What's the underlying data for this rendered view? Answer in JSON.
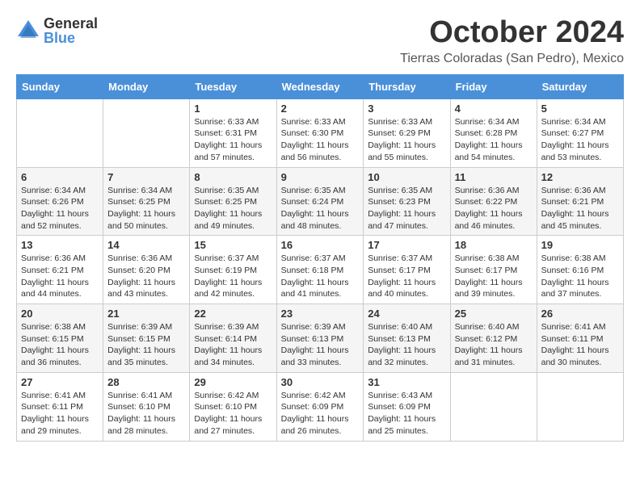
{
  "logo": {
    "general": "General",
    "blue": "Blue"
  },
  "header": {
    "month": "October 2024",
    "location": "Tierras Coloradas (San Pedro), Mexico"
  },
  "days_of_week": [
    "Sunday",
    "Monday",
    "Tuesday",
    "Wednesday",
    "Thursday",
    "Friday",
    "Saturday"
  ],
  "weeks": [
    [
      {
        "day": "",
        "info": ""
      },
      {
        "day": "",
        "info": ""
      },
      {
        "day": "1",
        "info": "Sunrise: 6:33 AM\nSunset: 6:31 PM\nDaylight: 11 hours and 57 minutes."
      },
      {
        "day": "2",
        "info": "Sunrise: 6:33 AM\nSunset: 6:30 PM\nDaylight: 11 hours and 56 minutes."
      },
      {
        "day": "3",
        "info": "Sunrise: 6:33 AM\nSunset: 6:29 PM\nDaylight: 11 hours and 55 minutes."
      },
      {
        "day": "4",
        "info": "Sunrise: 6:34 AM\nSunset: 6:28 PM\nDaylight: 11 hours and 54 minutes."
      },
      {
        "day": "5",
        "info": "Sunrise: 6:34 AM\nSunset: 6:27 PM\nDaylight: 11 hours and 53 minutes."
      }
    ],
    [
      {
        "day": "6",
        "info": "Sunrise: 6:34 AM\nSunset: 6:26 PM\nDaylight: 11 hours and 52 minutes."
      },
      {
        "day": "7",
        "info": "Sunrise: 6:34 AM\nSunset: 6:25 PM\nDaylight: 11 hours and 50 minutes."
      },
      {
        "day": "8",
        "info": "Sunrise: 6:35 AM\nSunset: 6:25 PM\nDaylight: 11 hours and 49 minutes."
      },
      {
        "day": "9",
        "info": "Sunrise: 6:35 AM\nSunset: 6:24 PM\nDaylight: 11 hours and 48 minutes."
      },
      {
        "day": "10",
        "info": "Sunrise: 6:35 AM\nSunset: 6:23 PM\nDaylight: 11 hours and 47 minutes."
      },
      {
        "day": "11",
        "info": "Sunrise: 6:36 AM\nSunset: 6:22 PM\nDaylight: 11 hours and 46 minutes."
      },
      {
        "day": "12",
        "info": "Sunrise: 6:36 AM\nSunset: 6:21 PM\nDaylight: 11 hours and 45 minutes."
      }
    ],
    [
      {
        "day": "13",
        "info": "Sunrise: 6:36 AM\nSunset: 6:21 PM\nDaylight: 11 hours and 44 minutes."
      },
      {
        "day": "14",
        "info": "Sunrise: 6:36 AM\nSunset: 6:20 PM\nDaylight: 11 hours and 43 minutes."
      },
      {
        "day": "15",
        "info": "Sunrise: 6:37 AM\nSunset: 6:19 PM\nDaylight: 11 hours and 42 minutes."
      },
      {
        "day": "16",
        "info": "Sunrise: 6:37 AM\nSunset: 6:18 PM\nDaylight: 11 hours and 41 minutes."
      },
      {
        "day": "17",
        "info": "Sunrise: 6:37 AM\nSunset: 6:17 PM\nDaylight: 11 hours and 40 minutes."
      },
      {
        "day": "18",
        "info": "Sunrise: 6:38 AM\nSunset: 6:17 PM\nDaylight: 11 hours and 39 minutes."
      },
      {
        "day": "19",
        "info": "Sunrise: 6:38 AM\nSunset: 6:16 PM\nDaylight: 11 hours and 37 minutes."
      }
    ],
    [
      {
        "day": "20",
        "info": "Sunrise: 6:38 AM\nSunset: 6:15 PM\nDaylight: 11 hours and 36 minutes."
      },
      {
        "day": "21",
        "info": "Sunrise: 6:39 AM\nSunset: 6:15 PM\nDaylight: 11 hours and 35 minutes."
      },
      {
        "day": "22",
        "info": "Sunrise: 6:39 AM\nSunset: 6:14 PM\nDaylight: 11 hours and 34 minutes."
      },
      {
        "day": "23",
        "info": "Sunrise: 6:39 AM\nSunset: 6:13 PM\nDaylight: 11 hours and 33 minutes."
      },
      {
        "day": "24",
        "info": "Sunrise: 6:40 AM\nSunset: 6:13 PM\nDaylight: 11 hours and 32 minutes."
      },
      {
        "day": "25",
        "info": "Sunrise: 6:40 AM\nSunset: 6:12 PM\nDaylight: 11 hours and 31 minutes."
      },
      {
        "day": "26",
        "info": "Sunrise: 6:41 AM\nSunset: 6:11 PM\nDaylight: 11 hours and 30 minutes."
      }
    ],
    [
      {
        "day": "27",
        "info": "Sunrise: 6:41 AM\nSunset: 6:11 PM\nDaylight: 11 hours and 29 minutes."
      },
      {
        "day": "28",
        "info": "Sunrise: 6:41 AM\nSunset: 6:10 PM\nDaylight: 11 hours and 28 minutes."
      },
      {
        "day": "29",
        "info": "Sunrise: 6:42 AM\nSunset: 6:10 PM\nDaylight: 11 hours and 27 minutes."
      },
      {
        "day": "30",
        "info": "Sunrise: 6:42 AM\nSunset: 6:09 PM\nDaylight: 11 hours and 26 minutes."
      },
      {
        "day": "31",
        "info": "Sunrise: 6:43 AM\nSunset: 6:09 PM\nDaylight: 11 hours and 25 minutes."
      },
      {
        "day": "",
        "info": ""
      },
      {
        "day": "",
        "info": ""
      }
    ]
  ]
}
